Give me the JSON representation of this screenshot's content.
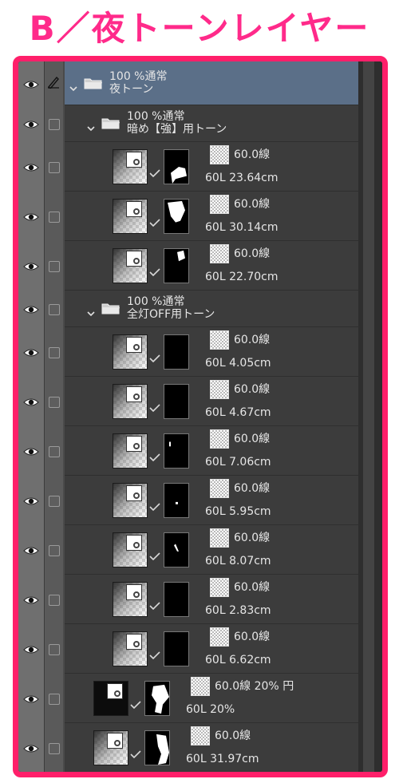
{
  "title": "B／夜トーンレイヤー",
  "colors": {
    "title": "#ff2a8a",
    "frame": "#ff1f6a",
    "panel": "#3c3c3c",
    "selected": "#5b6f88"
  },
  "icons": {
    "visibility": "eye-icon",
    "draft": "pencil-icon",
    "folder": "folder-icon",
    "expand": "chevron-down-icon",
    "link": "checkmark-icon"
  },
  "root_folder": {
    "mode": "100 %通常",
    "name": "夜トーン"
  },
  "group1": {
    "mode": "100 %通常",
    "name": "暗め【強】用トーン",
    "layers": [
      {
        "tone": "60.0線",
        "detail": "60L 23.64cm",
        "mask": "shapeA"
      },
      {
        "tone": "60.0線",
        "detail": "60L 30.14cm",
        "mask": "shapeB"
      },
      {
        "tone": "60.0線",
        "detail": "60L 22.70cm",
        "mask": "shapeC"
      }
    ]
  },
  "group2": {
    "mode": "100 %通常",
    "name": "全灯OFF用トーン",
    "layers": [
      {
        "tone": "60.0線",
        "detail": "60L 4.05cm",
        "mask": "none"
      },
      {
        "tone": "60.0線",
        "detail": "60L 4.67cm",
        "mask": "none"
      },
      {
        "tone": "60.0線",
        "detail": "60L 7.06cm",
        "mask": "dot1"
      },
      {
        "tone": "60.0線",
        "detail": "60L 5.95cm",
        "mask": "dot2"
      },
      {
        "tone": "60.0線",
        "detail": "60L 8.07cm",
        "mask": "dot3"
      },
      {
        "tone": "60.0線",
        "detail": "60L 2.83cm",
        "mask": "none"
      },
      {
        "tone": "60.0線",
        "detail": "60L 6.62cm",
        "mask": "none"
      }
    ]
  },
  "bottom_layers": [
    {
      "tone": "60.0線 20% 円",
      "detail": "60L 20%",
      "mask": "shapeD"
    },
    {
      "tone": "60.0線",
      "detail": "60L 31.97cm",
      "mask": "shapeE"
    }
  ]
}
